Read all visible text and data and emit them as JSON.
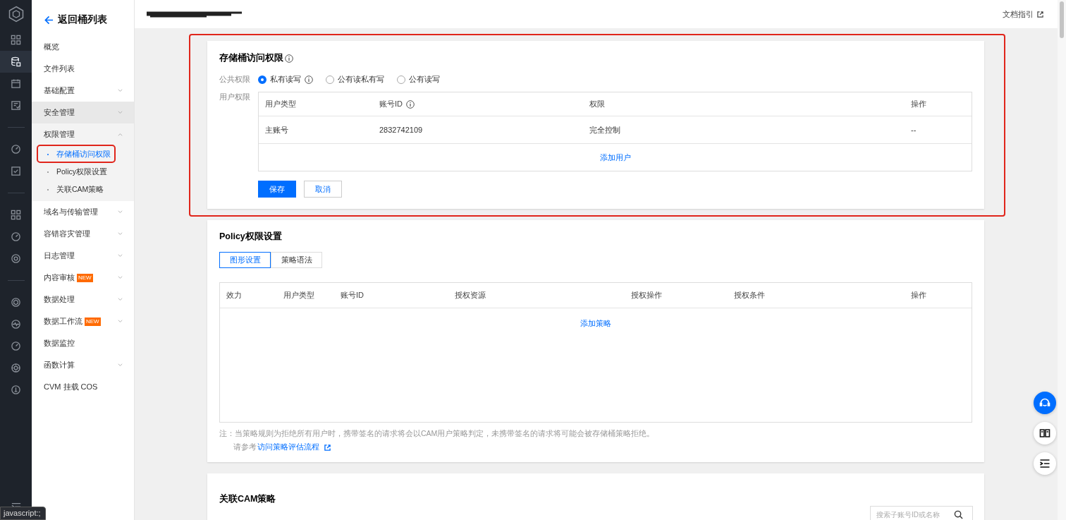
{
  "rail": {
    "items": [
      {
        "kind": "icon",
        "selected": false
      },
      {
        "kind": "icon",
        "selected": true
      },
      {
        "kind": "icon",
        "selected": false
      },
      {
        "kind": "icon",
        "selected": false
      },
      {
        "kind": "divider"
      },
      {
        "kind": "icon",
        "selected": false
      },
      {
        "kind": "icon",
        "selected": false
      },
      {
        "kind": "divider"
      },
      {
        "kind": "icon",
        "selected": false
      },
      {
        "kind": "icon",
        "selected": false
      },
      {
        "kind": "icon",
        "selected": false
      },
      {
        "kind": "divider"
      },
      {
        "kind": "icon",
        "selected": false
      },
      {
        "kind": "icon",
        "selected": false
      },
      {
        "kind": "icon",
        "selected": false
      },
      {
        "kind": "icon",
        "selected": false
      },
      {
        "kind": "icon",
        "selected": false
      }
    ]
  },
  "sidebar": {
    "back_label": "返回桶列表",
    "items": [
      {
        "label": "概览",
        "expandable": false,
        "hovered": false
      },
      {
        "label": "文件列表",
        "expandable": false,
        "hovered": false
      },
      {
        "label": "基础配置",
        "expandable": true,
        "expanded": false,
        "hovered": false
      },
      {
        "label": "安全管理",
        "expandable": true,
        "expanded": false,
        "hovered": true
      },
      {
        "label": "权限管理",
        "expandable": true,
        "expanded": true,
        "hovered": false,
        "children": [
          {
            "label": "存储桶访问权限",
            "selected": true,
            "highlighted": true
          },
          {
            "label": "Policy权限设置",
            "selected": false,
            "highlighted": false
          },
          {
            "label": "关联CAM策略",
            "selected": false,
            "highlighted": false
          }
        ]
      },
      {
        "label": "域名与传输管理",
        "expandable": true,
        "expanded": false,
        "hovered": false
      },
      {
        "label": "容错容灾管理",
        "expandable": true,
        "expanded": false,
        "hovered": false
      },
      {
        "label": "日志管理",
        "expandable": true,
        "expanded": false,
        "hovered": false
      },
      {
        "label": "内容审核",
        "badge": "NEW",
        "expandable": true,
        "expanded": false,
        "hovered": false
      },
      {
        "label": "数据处理",
        "expandable": true,
        "expanded": false,
        "hovered": false
      },
      {
        "label": "数据工作流",
        "badge": "NEW",
        "expandable": true,
        "expanded": false,
        "hovered": false
      },
      {
        "label": "数据监控",
        "expandable": false,
        "hovered": false
      },
      {
        "label": "函数计算",
        "expandable": true,
        "expanded": false,
        "hovered": false
      },
      {
        "label": "CVM 挂载 COS",
        "expandable": false,
        "hovered": false
      }
    ]
  },
  "header": {
    "title_redacted": true,
    "doc_link": "文档指引"
  },
  "access_card": {
    "title": "存储桶访问权限",
    "highlighted": true,
    "public_label": "公共权限",
    "public_options": [
      {
        "label": "私有读写",
        "selected": true,
        "info": true
      },
      {
        "label": "公有读私有写",
        "selected": false,
        "info": false
      },
      {
        "label": "公有读写",
        "selected": false,
        "info": false
      }
    ],
    "user_label": "用户权限",
    "table": {
      "columns": [
        {
          "label": "用户类型",
          "info": false
        },
        {
          "label": "账号ID",
          "info": true
        },
        {
          "label": "权限",
          "info": false
        },
        {
          "label": "操作",
          "info": false
        }
      ],
      "rows": [
        [
          "主账号",
          "2832742109",
          "完全控制",
          "--"
        ]
      ],
      "add_link": "添加用户"
    },
    "buttons": [
      {
        "label": "保存",
        "kind": "primary"
      },
      {
        "label": "取消",
        "kind": "default"
      }
    ]
  },
  "policy_card": {
    "title": "Policy权限设置",
    "tabs": [
      {
        "label": "图形设置",
        "selected": true
      },
      {
        "label": "策略语法",
        "selected": false
      }
    ],
    "table": {
      "columns": [
        "效力",
        "用户类型",
        "账号ID",
        "授权资源",
        "授权操作",
        "授权条件",
        "操作"
      ],
      "add_link": "添加策略"
    },
    "note_prefix": "注：",
    "note": "当策略规则为拒绝所有用户时，携带签名的请求将会以CAM用户策略判定，未携带签名的请求将可能会被存储桶策略拒绝。",
    "refer_prefix": "请参考",
    "refer_link": "访问策略评估流程"
  },
  "cam_card": {
    "title": "关联CAM策略",
    "search": {
      "placeholder": "搜索子账号ID或名称"
    }
  },
  "status_tooltip": "javascript:;"
}
